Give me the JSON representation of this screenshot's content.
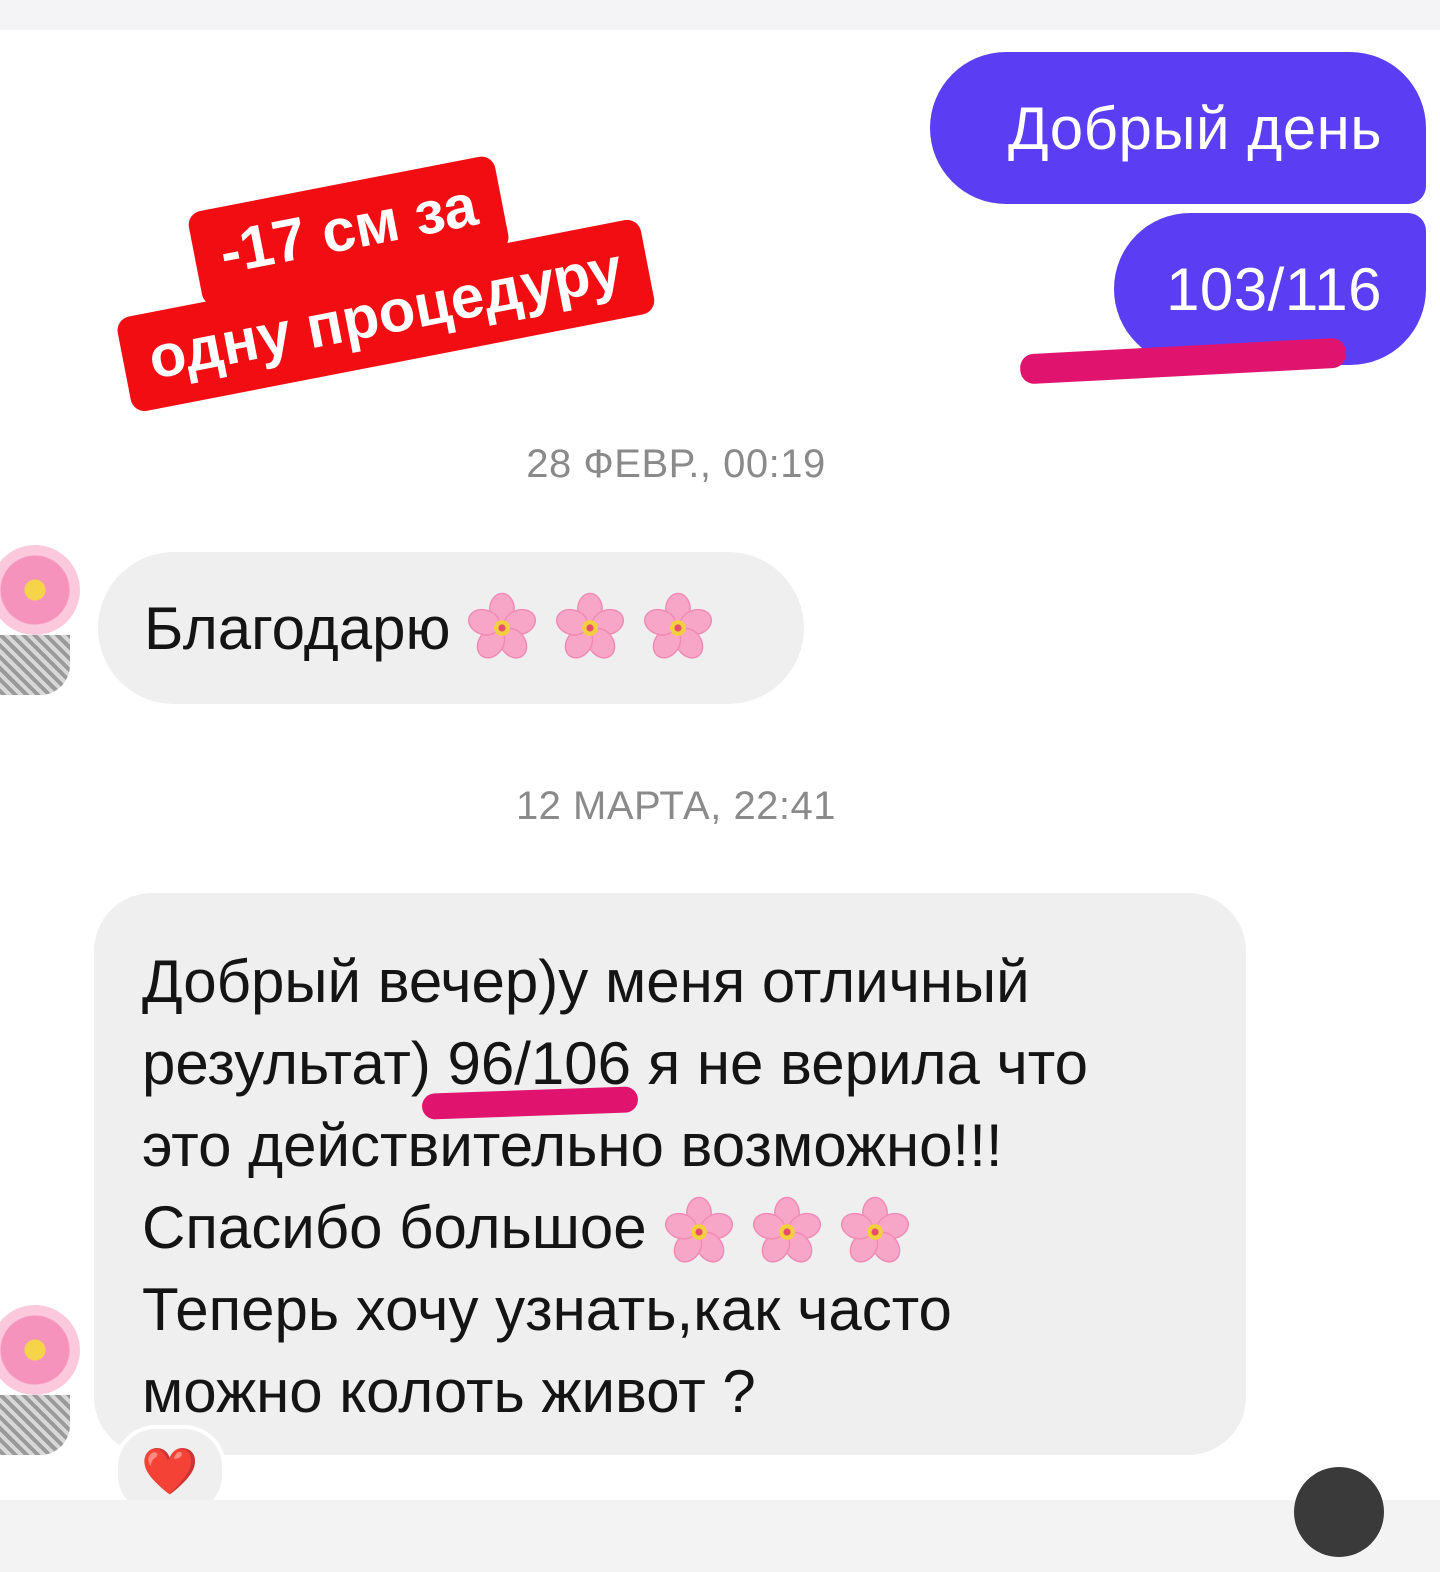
{
  "overlay": {
    "promo_line_1": "-17 см за",
    "promo_line_2": "одну процедуру",
    "promo_color": "#f20d12",
    "highlight_color": "#e0146e"
  },
  "conversation": {
    "outgoing": [
      {
        "text": "Добрый день"
      },
      {
        "text": "103/116"
      }
    ],
    "timestamps": [
      "28 ФЕВР., 00:19",
      "12 МАРТА, 22:41"
    ],
    "incoming": [
      {
        "lines": [
          "Благодарю"
        ],
        "emoji": "cherry-blossom-icon",
        "emoji_count": 3
      },
      {
        "lines": [
          "Добрый вечер)у меня отличный",
          "результат) 96/106 я не верила что",
          "это действительно возможно!!!",
          "Спасибо большое",
          "Теперь хочу узнать,как часто",
          "можно колоть живот ?"
        ],
        "emoji": "cherry-blossom-icon",
        "emoji_count": 3,
        "reaction": "❤️"
      }
    ],
    "colors": {
      "outgoing_bubble": "#5b3df3",
      "incoming_bubble": "#efeff0",
      "timestamp_text": "#8a8a8a"
    }
  }
}
